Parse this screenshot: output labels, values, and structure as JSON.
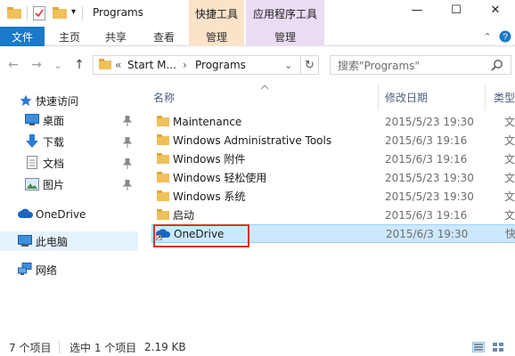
{
  "window": {
    "title": "Programs",
    "minimize_glyph": "—",
    "maximize_glyph": "☐",
    "close_glyph": "✕"
  },
  "context_tabs": {
    "shortcut_tools": "快捷工具",
    "app_tools": "应用程序工具"
  },
  "ribbon": {
    "tabs": [
      "文件",
      "主页",
      "共享",
      "查看",
      "管理",
      "管理"
    ],
    "file_color": "#1979ca",
    "collapse_glyph": "⌃",
    "help_glyph": "?"
  },
  "address": {
    "prefix": "«",
    "path1": "Start M...",
    "separator": "›",
    "path2": "Programs",
    "dropdown_glyph": "⌄",
    "refresh_glyph": "↻",
    "search_placeholder": "搜索\"Programs\""
  },
  "nav": {
    "back": "←",
    "forward": "→",
    "recent": "⌄",
    "up": "↑"
  },
  "navpane": {
    "items": [
      {
        "label": "快速访问",
        "icon": "star-icon"
      },
      {
        "label": "桌面",
        "icon": "desktop-icon"
      },
      {
        "label": "下载",
        "icon": "download-icon"
      },
      {
        "label": "文档",
        "icon": "document-icon"
      },
      {
        "label": "图片",
        "icon": "picture-icon"
      },
      {
        "label": "OneDrive",
        "icon": "onedrive-icon"
      },
      {
        "label": "此电脑",
        "icon": "computer-icon"
      },
      {
        "label": "网络",
        "icon": "network-icon"
      }
    ]
  },
  "columns": {
    "name": "名称",
    "modified": "修改日期",
    "type": "类型"
  },
  "files": [
    {
      "name": "Maintenance",
      "date": "2015/5/23 19:30",
      "type": "文件",
      "icon": "folder-icon"
    },
    {
      "name": "Windows Administrative Tools",
      "date": "2015/6/3 19:16",
      "type": "文件",
      "icon": "folder-icon"
    },
    {
      "name": "Windows 附件",
      "date": "2015/6/3 19:16",
      "type": "文件",
      "icon": "folder-icon"
    },
    {
      "name": "Windows 轻松使用",
      "date": "2015/5/23 19:30",
      "type": "文件",
      "icon": "folder-icon"
    },
    {
      "name": "Windows 系统",
      "date": "2015/5/23 19:30",
      "type": "文件",
      "icon": "folder-icon"
    },
    {
      "name": "启动",
      "date": "2015/6/3 19:16",
      "type": "文件",
      "icon": "folder-icon"
    },
    {
      "name": "OneDrive",
      "date": "2015/6/3 19:30",
      "type": "快捷",
      "icon": "onedrive-shortcut-icon"
    }
  ],
  "status": {
    "count": "7 个项目",
    "selected": "选中 1 个项目",
    "size": "2.19 KB"
  },
  "colors": {
    "selection_bg": "#cce8ff",
    "highlight_box": "#d9302c",
    "folder": "#f0c05a"
  }
}
